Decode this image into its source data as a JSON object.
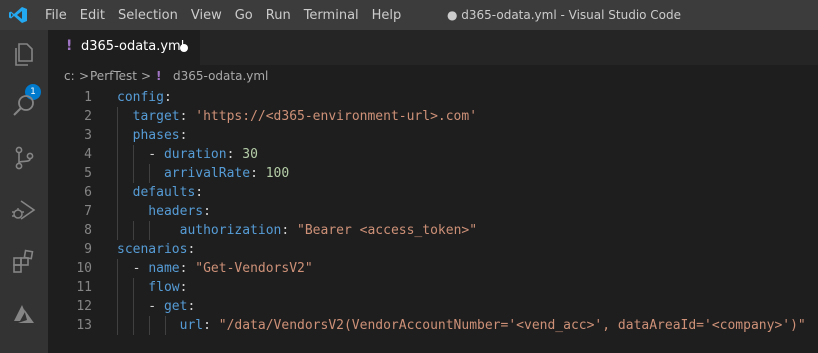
{
  "titlebar": {
    "menu": [
      "File",
      "Edit",
      "Selection",
      "View",
      "Go",
      "Run",
      "Terminal",
      "Help"
    ],
    "title": "● d365-odata.yml - Visual Studio Code"
  },
  "activity_bar": {
    "items": [
      "explorer-icon",
      "search-icon",
      "source-control-icon",
      "run-debug-icon",
      "extensions-icon",
      "azure-icon"
    ],
    "explorer_badge": "1"
  },
  "tab": {
    "icon": "!",
    "label": "d365-odata.yml"
  },
  "breadcrumb": {
    "drive": "c:",
    "sep1": ">",
    "folder": "PerfTest",
    "sep2": ">",
    "icon": "!",
    "file": "d365-odata.yml"
  },
  "editor": {
    "lines": [
      {
        "n": "1",
        "tokens": [
          {
            "t": "config",
            "c": "key"
          },
          {
            "t": ":",
            "c": "pun"
          }
        ]
      },
      {
        "n": "2",
        "tokens": [
          {
            "t": "  target",
            "c": "key"
          },
          {
            "t": ": ",
            "c": "pun"
          },
          {
            "t": "'https://<d365-environment-url>.com'",
            "c": "str"
          }
        ]
      },
      {
        "n": "3",
        "tokens": [
          {
            "t": "  phases",
            "c": "key"
          },
          {
            "t": ":",
            "c": "pun"
          }
        ]
      },
      {
        "n": "4",
        "tokens": [
          {
            "t": "    - ",
            "c": "pun"
          },
          {
            "t": "duration",
            "c": "key"
          },
          {
            "t": ": ",
            "c": "pun"
          },
          {
            "t": "30",
            "c": "num"
          }
        ]
      },
      {
        "n": "5",
        "tokens": [
          {
            "t": "      arrivalRate",
            "c": "key"
          },
          {
            "t": ": ",
            "c": "pun"
          },
          {
            "t": "100",
            "c": "num"
          }
        ]
      },
      {
        "n": "6",
        "tokens": [
          {
            "t": "  defaults",
            "c": "key"
          },
          {
            "t": ":",
            "c": "pun"
          }
        ]
      },
      {
        "n": "7",
        "tokens": [
          {
            "t": "    headers",
            "c": "key"
          },
          {
            "t": ":",
            "c": "pun"
          }
        ]
      },
      {
        "n": "8",
        "tokens": [
          {
            "t": "        authorization",
            "c": "key"
          },
          {
            "t": ": ",
            "c": "pun"
          },
          {
            "t": "\"Bearer <access_token>\"",
            "c": "str"
          }
        ]
      },
      {
        "n": "9",
        "tokens": [
          {
            "t": "scenarios",
            "c": "key"
          },
          {
            "t": ":",
            "c": "pun"
          }
        ]
      },
      {
        "n": "10",
        "tokens": [
          {
            "t": "  - ",
            "c": "pun"
          },
          {
            "t": "name",
            "c": "key"
          },
          {
            "t": ": ",
            "c": "pun"
          },
          {
            "t": "\"Get-VendorsV2\"",
            "c": "str"
          }
        ]
      },
      {
        "n": "11",
        "tokens": [
          {
            "t": "    flow",
            "c": "key"
          },
          {
            "t": ":",
            "c": "pun"
          }
        ]
      },
      {
        "n": "12",
        "tokens": [
          {
            "t": "    - ",
            "c": "pun"
          },
          {
            "t": "get",
            "c": "key"
          },
          {
            "t": ":",
            "c": "pun"
          }
        ]
      },
      {
        "n": "13",
        "tokens": [
          {
            "t": "        url",
            "c": "key"
          },
          {
            "t": ": ",
            "c": "pun"
          },
          {
            "t": "\"/data/VendorsV2(VendorAccountNumber='<vend_acc>', dataAreaId='<company>')\"",
            "c": "str"
          }
        ]
      }
    ]
  },
  "colors": {
    "key": "#569cd6",
    "string": "#ce9178",
    "number": "#b5cea8",
    "accent": "#007acc"
  }
}
